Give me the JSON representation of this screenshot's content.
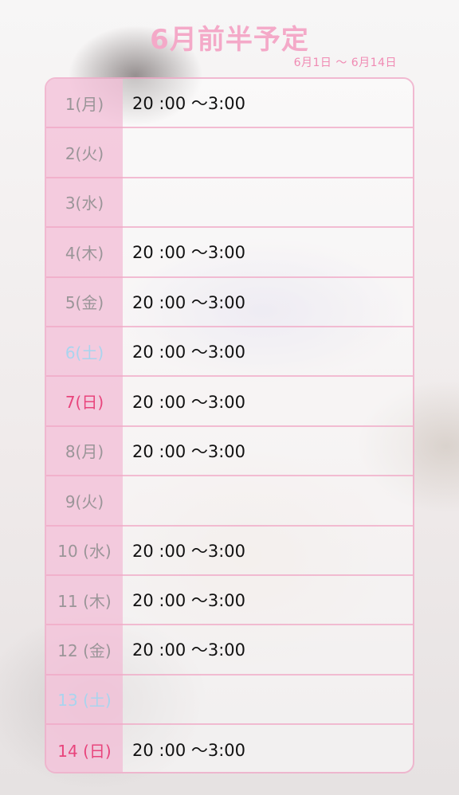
{
  "header": {
    "title": "6月前半予定",
    "range": "6月1日 〜 6月14日"
  },
  "colors": {
    "title": "#f4a9c8",
    "day_column": "#f3c4da",
    "weekday": "#9a9598",
    "saturday": "#a9d4ee",
    "sunday": "#e8447c"
  },
  "schedule": [
    {
      "day": "1(月)",
      "time": "20 :00 〜3:00",
      "type": "weekday"
    },
    {
      "day": "2(火)",
      "time": "",
      "type": "weekday"
    },
    {
      "day": "3(水)",
      "time": "",
      "type": "weekday"
    },
    {
      "day": "4(木)",
      "time": "20 :00 〜3:00",
      "type": "weekday"
    },
    {
      "day": "5(金)",
      "time": "20 :00 〜3:00",
      "type": "weekday"
    },
    {
      "day": "6(土)",
      "time": "20 :00 〜3:00",
      "type": "sat"
    },
    {
      "day": "7(日)",
      "time": "20 :00 〜3:00",
      "type": "sun"
    },
    {
      "day": "8(月)",
      "time": "20 :00 〜3:00",
      "type": "weekday"
    },
    {
      "day": "9(火)",
      "time": "",
      "type": "weekday"
    },
    {
      "day": "10 (水)",
      "time": "20 :00 〜3:00",
      "type": "weekday"
    },
    {
      "day": "11 (木)",
      "time": "20 :00 〜3:00",
      "type": "weekday"
    },
    {
      "day": "12 (金)",
      "time": "20 :00 〜3:00",
      "type": "weekday"
    },
    {
      "day": "13 (土)",
      "time": "",
      "type": "sat"
    },
    {
      "day": "14 (日)",
      "time": "20 :00 〜3:00",
      "type": "sun"
    }
  ]
}
